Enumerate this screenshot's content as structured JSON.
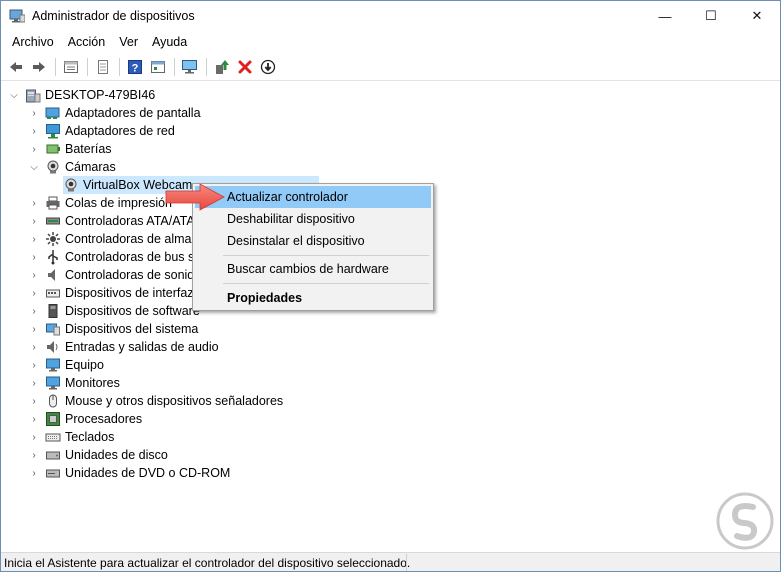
{
  "window": {
    "title": "Administrador de dispositivos",
    "buttons": {
      "minimize": "—",
      "maximize": "☐",
      "close": "✕"
    }
  },
  "menu": [
    "Archivo",
    "Acción",
    "Ver",
    "Ayuda"
  ],
  "toolbar": [
    "back-icon",
    "forward-icon",
    "properties-icon",
    "list-icon",
    "help-icon",
    "action-icon",
    "monitor-icon",
    "update-driver-icon",
    "remove-icon",
    "download-icon"
  ],
  "tree": {
    "root": "DESKTOP-479BI46",
    "categories": [
      {
        "label": "Adaptadores de pantalla",
        "icon": "display-adapter-icon",
        "expanded": false
      },
      {
        "label": "Adaptadores de red",
        "icon": "network-adapter-icon",
        "expanded": false
      },
      {
        "label": "Baterías",
        "icon": "battery-icon",
        "expanded": false
      },
      {
        "label": "Cámaras",
        "icon": "camera-icon",
        "expanded": true,
        "children": [
          "VirtualBox Webcam"
        ]
      },
      {
        "label": "Colas de impresión",
        "icon": "printer-icon",
        "expanded": false
      },
      {
        "label": "Controladoras ATA/ATA",
        "icon": "ide-controller-icon",
        "expanded": false
      },
      {
        "label": "Controladoras de almac",
        "icon": "storage-controller-icon",
        "expanded": false
      },
      {
        "label": "Controladoras de bus se",
        "icon": "usb-controller-icon",
        "expanded": false
      },
      {
        "label": "Controladoras de sonido",
        "icon": "sound-icon",
        "expanded": false
      },
      {
        "label": "Dispositivos de interfaz c",
        "icon": "hid-icon",
        "expanded": false
      },
      {
        "label": "Dispositivos de software",
        "icon": "software-device-icon",
        "expanded": false
      },
      {
        "label": "Dispositivos del sistema",
        "icon": "system-device-icon",
        "expanded": false
      },
      {
        "label": "Entradas y salidas de audio",
        "icon": "audio-io-icon",
        "expanded": false
      },
      {
        "label": "Equipo",
        "icon": "computer-icon",
        "expanded": false
      },
      {
        "label": "Monitores",
        "icon": "monitor-icon",
        "expanded": false
      },
      {
        "label": "Mouse y otros dispositivos señaladores",
        "icon": "mouse-icon",
        "expanded": false
      },
      {
        "label": "Procesadores",
        "icon": "processor-icon",
        "expanded": false
      },
      {
        "label": "Teclados",
        "icon": "keyboard-icon",
        "expanded": false
      },
      {
        "label": "Unidades de disco",
        "icon": "disk-drive-icon",
        "expanded": false
      },
      {
        "label": "Unidades de DVD o CD-ROM",
        "icon": "dvd-drive-icon",
        "expanded": false
      }
    ]
  },
  "context_menu": {
    "items": [
      "Actualizar controlador",
      "Deshabilitar dispositivo",
      "Desinstalar el dispositivo",
      "Buscar cambios de hardware",
      "Propiedades"
    ],
    "highlighted": "Actualizar controlador"
  },
  "status": "Inicia el Asistente para actualizar el controlador del dispositivo seleccionado.",
  "colors": {
    "highlight": "#91c9f7",
    "selection": "#cce8ff",
    "arrow": "#f25c54",
    "remove_red": "#e02020",
    "update_green": "#2e8b3d"
  }
}
